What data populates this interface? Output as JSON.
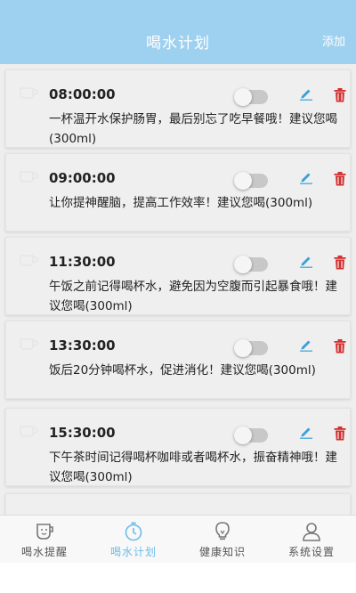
{
  "header": {
    "title": "喝水计划",
    "add_label": "添加"
  },
  "plans": [
    {
      "time": "08:00:00",
      "message": "一杯温开水保护肠胃，最后别忘了吃早餐哦！建议您喝(300ml)",
      "enabled": false
    },
    {
      "time": "09:00:00",
      "message": "让你提神醒脑，提高工作效率！建议您喝(300ml)",
      "enabled": false
    },
    {
      "time": "11:30:00",
      "message": "午饭之前记得喝杯水，避免因为空腹而引起暴食哦！建议您喝(300ml)",
      "enabled": false
    },
    {
      "time": "13:30:00",
      "message": "饭后20分钟喝杯水，促进消化！建议您喝(300ml)",
      "enabled": false
    },
    {
      "time": "15:30:00",
      "message": "下午茶时间记得喝杯咖啡或者喝杯水，振奋精神哦！建议您喝(300ml)",
      "enabled": false
    }
  ],
  "tabs": [
    {
      "label": "喝水提醒",
      "icon": "cup-icon",
      "active": false
    },
    {
      "label": "喝水计划",
      "icon": "timer-icon",
      "active": true
    },
    {
      "label": "健康知识",
      "icon": "lightbulb-icon",
      "active": false
    },
    {
      "label": "系统设置",
      "icon": "user-icon",
      "active": false
    }
  ],
  "colors": {
    "header": "#9ed1f0",
    "accent": "#6cbde8",
    "edit": "#3aa0d8",
    "delete": "#d32f2f"
  }
}
